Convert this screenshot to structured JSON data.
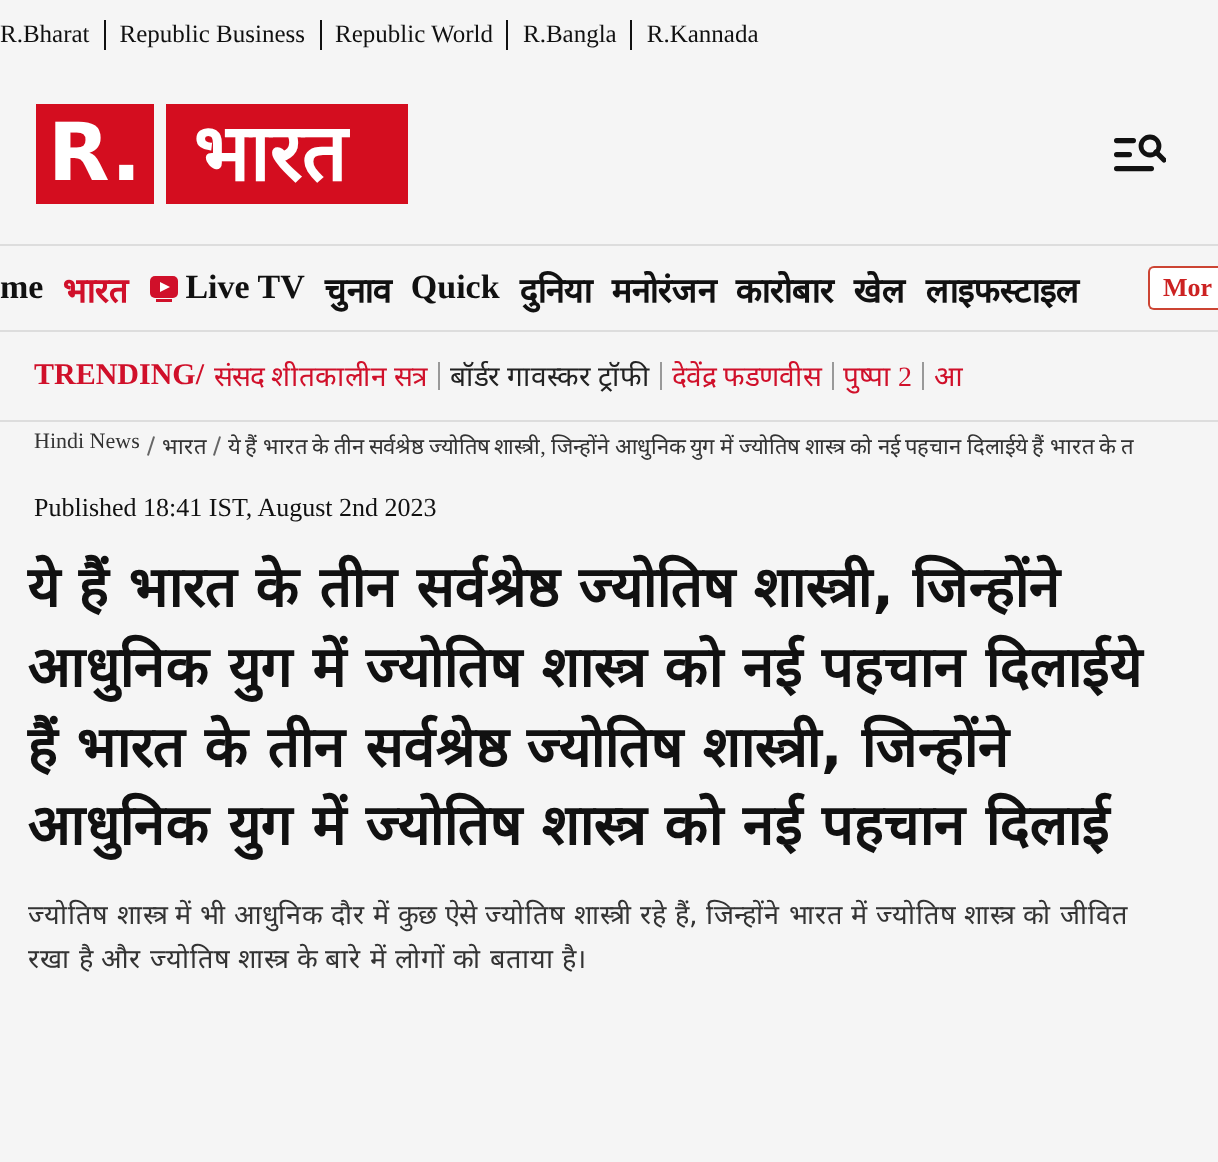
{
  "top_links": [
    "R.Bharat",
    "Republic Business",
    "Republic World",
    "R.Bangla",
    "R.Kannada"
  ],
  "logo": {
    "prefix": "R.",
    "name": "भारत"
  },
  "nav": [
    {
      "label": "me",
      "selected": false,
      "kind": "text"
    },
    {
      "label": "भारत",
      "selected": true,
      "kind": "text"
    },
    {
      "label": "Live TV",
      "selected": false,
      "kind": "live"
    },
    {
      "label": "चुनाव",
      "selected": false,
      "kind": "text"
    },
    {
      "label": "Quick",
      "selected": false,
      "kind": "text"
    },
    {
      "label": "दुनिया",
      "selected": false,
      "kind": "text"
    },
    {
      "label": "मनोरंजन",
      "selected": false,
      "kind": "text"
    },
    {
      "label": "कारोबार",
      "selected": false,
      "kind": "text"
    },
    {
      "label": "खेल",
      "selected": false,
      "kind": "text"
    },
    {
      "label": "लाइफस्टाइल",
      "selected": false,
      "kind": "text"
    }
  ],
  "more_button": "Mor",
  "trending": {
    "label": "TRENDING/",
    "items": [
      {
        "text": "संसद शीतकालीन सत्र",
        "color": "#d0102a"
      },
      {
        "text": "बॉर्डर गावस्कर ट्रॉफी",
        "color": "#222222"
      },
      {
        "text": "देवेंद्र फडणवीस",
        "color": "#d0102a"
      },
      {
        "text": "पुष्पा 2",
        "color": "#d0102a"
      },
      {
        "text": "आ",
        "color": "#d0102a"
      }
    ]
  },
  "breadcrumb": [
    "Hindi News",
    "भारत",
    "ये हैं भारत के तीन सर्वश्रेष्ठ ज्योतिष शास्त्री, जिन्होंने आधुनिक युग में ज्योतिष शास्त्र को नई पहचान दिलाईये हैं भारत के त"
  ],
  "published": "Published 18:41 IST, August 2nd 2023",
  "headline": "ये हैं भारत के तीन सर्वश्रेष्ठ ज्योतिष शास्त्री, जिन्होंने आधुनिक युग में ज्योतिष शास्त्र को नई पहचान दिलाईये हैं भारत के तीन सर्वश्रेष्ठ ज्योतिष शास्त्री, जिन्होंने आधुनिक युग में ज्योतिष शास्त्र को नई पहचान दिलाई",
  "summary": "ज्योतिष शास्त्र में भी आधुनिक दौर में कुछ ऐसे ज्योतिष शास्त्री रहे हैं, जिन्होंने भारत में ज्योतिष शास्त्र को जीवित रखा है और ज्योतिष शास्त्र के बारे में लोगों को बताया है।"
}
